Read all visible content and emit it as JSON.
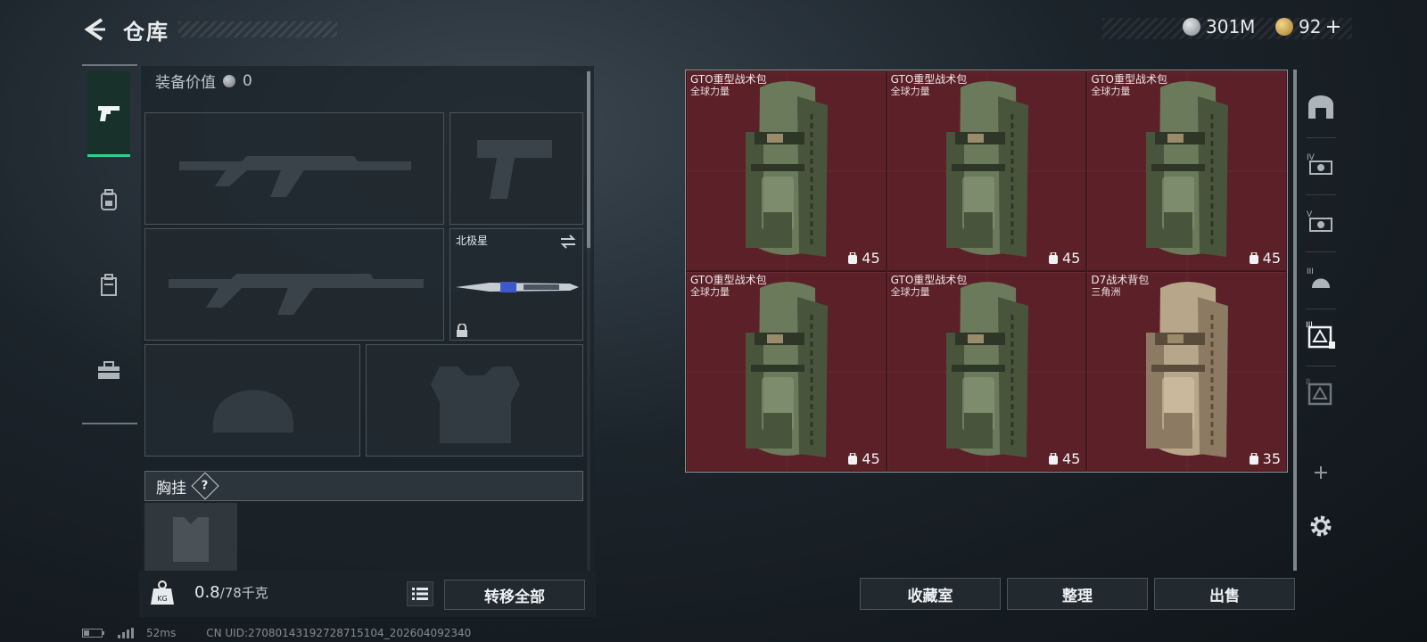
{
  "header": {
    "title": "仓库",
    "currency_1": "301M",
    "currency_2": "92"
  },
  "left_panel": {
    "gear_value_label": "装备价值",
    "gear_value": "0",
    "melee_name": "北极星",
    "chest_label": "胸挂",
    "chest_help": "?",
    "weight_current": "0.8",
    "weight_max": "/78千克",
    "weight_icon_text": "KG",
    "transfer_all": "转移全部"
  },
  "items": [
    {
      "name": "GTO重型战术包",
      "brand": "全球力量",
      "capacity": "45",
      "color": "green"
    },
    {
      "name": "GTO重型战术包",
      "brand": "全球力量",
      "capacity": "45",
      "color": "green"
    },
    {
      "name": "GTO重型战术包",
      "brand": "全球力量",
      "capacity": "45",
      "color": "green"
    },
    {
      "name": "GTO重型战术包",
      "brand": "全球力量",
      "capacity": "45",
      "color": "green"
    },
    {
      "name": "GTO重型战术包",
      "brand": "全球力量",
      "capacity": "45",
      "color": "green"
    },
    {
      "name": "D7战术背包",
      "brand": "三角洲",
      "capacity": "35",
      "color": "tan"
    }
  ],
  "bottom_buttons": {
    "collection": "收藏室",
    "organize": "整理",
    "sell": "出售"
  },
  "footer": {
    "ping": "52ms",
    "uid": "CN UID:27080143192728715104_202604092340"
  },
  "colors": {
    "item_bg": "#5b2028",
    "accent_green": "#2fd18a"
  }
}
